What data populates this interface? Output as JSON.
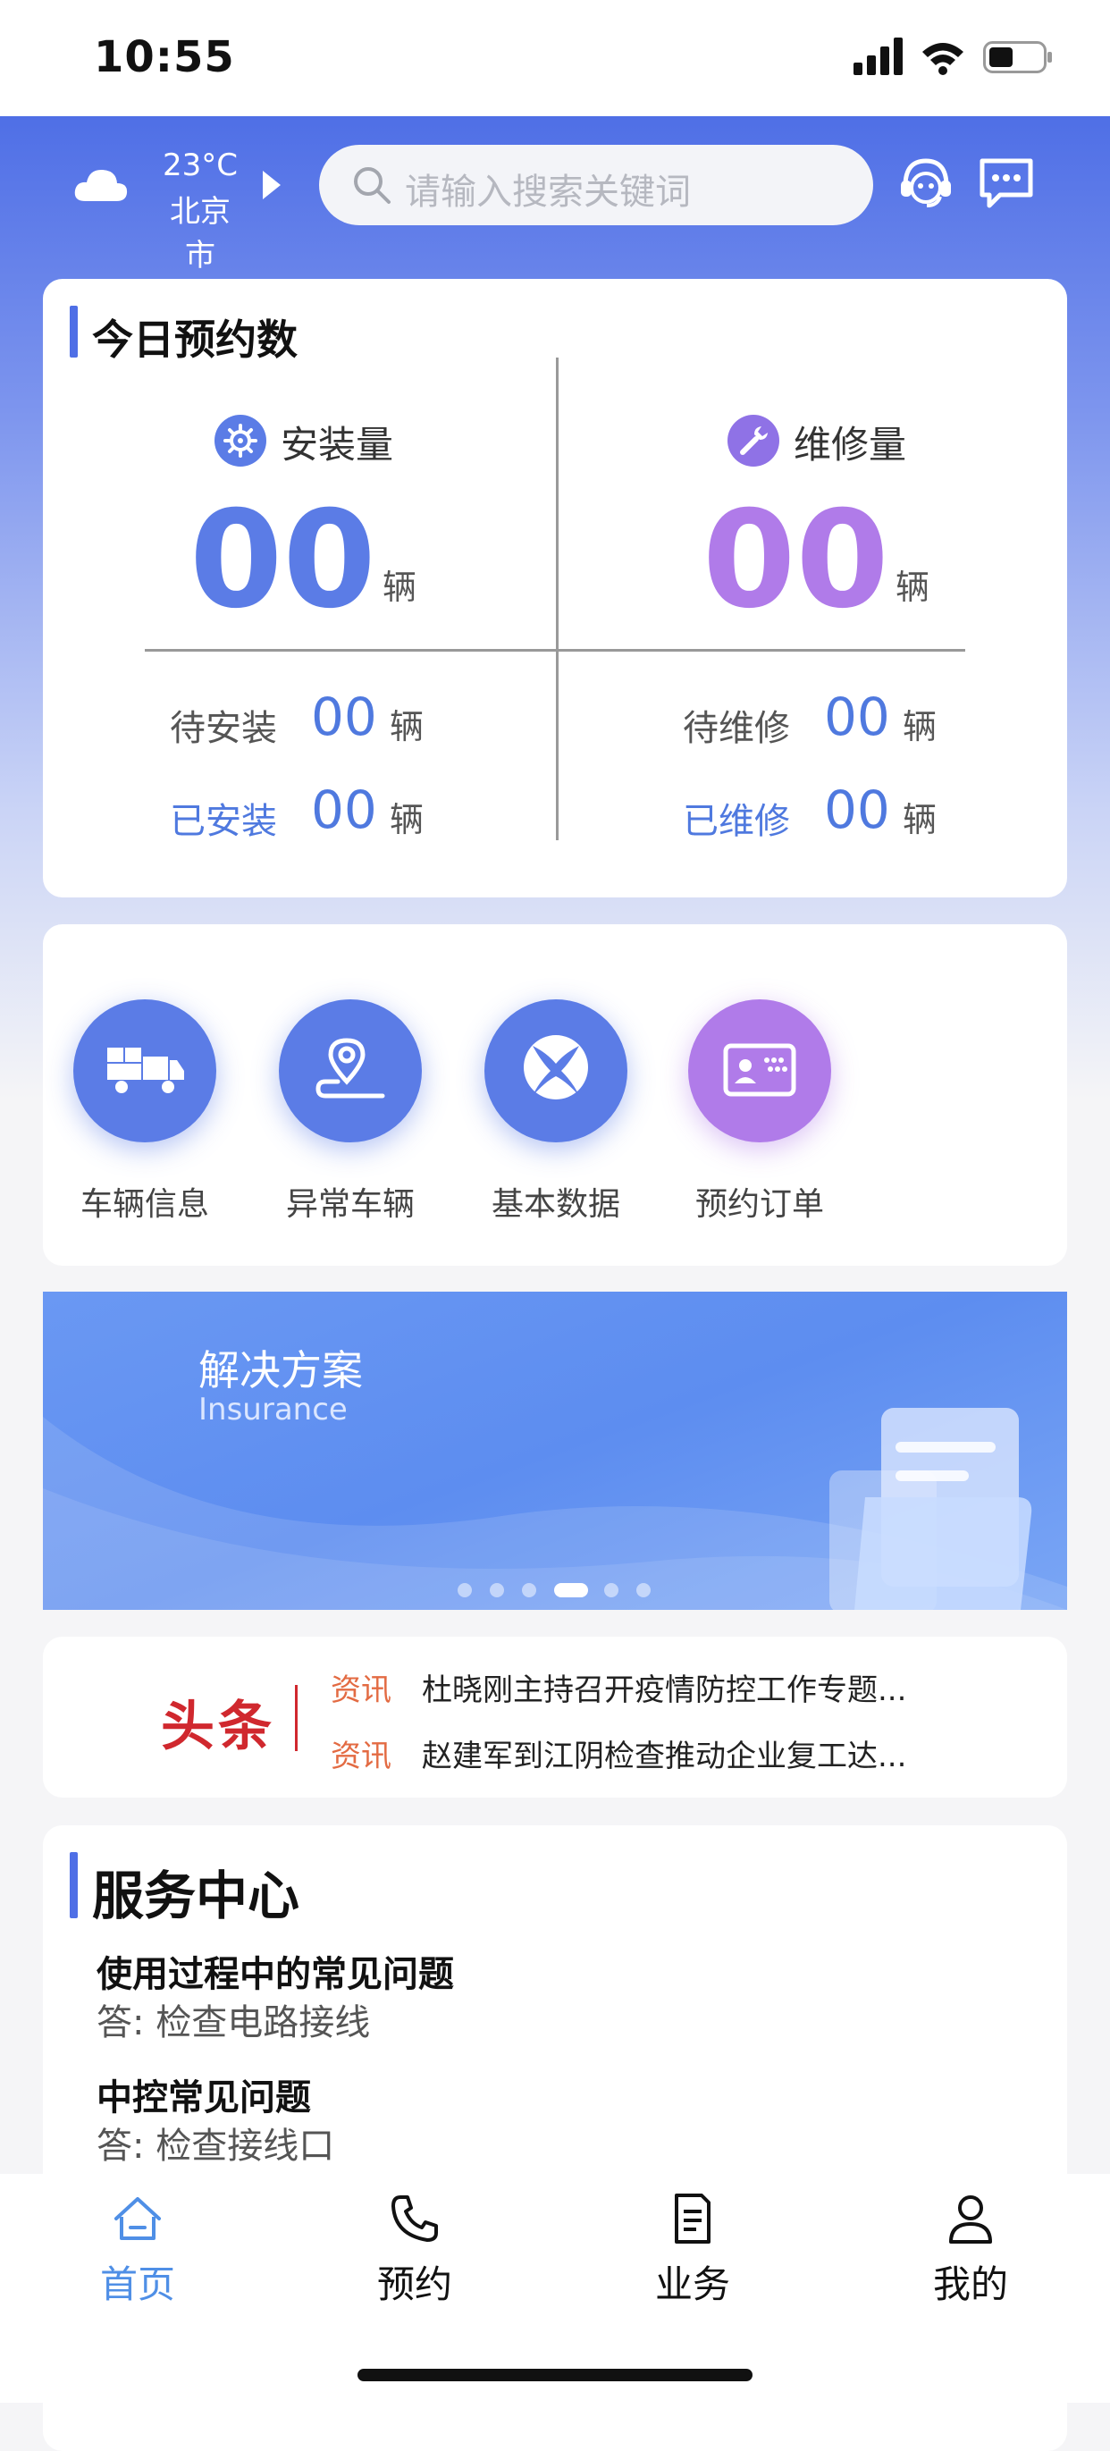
{
  "status_bar": {
    "time": "10:55"
  },
  "header": {
    "temperature": "23°C",
    "city": "北京市",
    "search_placeholder": "请输入搜索关键词"
  },
  "stats": {
    "title": "今日预约数",
    "install": {
      "label": "安装量",
      "count": "00",
      "unit": "辆",
      "pending_label": "待安装",
      "pending_count": "00",
      "pending_unit": "辆",
      "done_label": "已安装",
      "done_count": "00",
      "done_unit": "辆"
    },
    "repair": {
      "label": "维修量",
      "count": "00",
      "unit": "辆",
      "pending_label": "待维修",
      "pending_count": "00",
      "pending_unit": "辆",
      "done_label": "已维修",
      "done_count": "00",
      "done_unit": "辆"
    },
    "colors": {
      "blue": "#5b7ce6",
      "purple": "#b07be9"
    }
  },
  "menu": {
    "items": [
      {
        "label": "车辆信息",
        "icon": "truck-icon"
      },
      {
        "label": "异常车辆",
        "icon": "location-pin-icon"
      },
      {
        "label": "基本数据",
        "icon": "xbox-icon"
      },
      {
        "label": "预约订单",
        "icon": "id-card-icon"
      }
    ]
  },
  "banner": {
    "title": "解决方案",
    "subtitle": "Insurance",
    "slide_count": 6,
    "active_slide": 4
  },
  "news": {
    "headline": "头条",
    "items": [
      {
        "tag": "资讯",
        "text": "杜晓刚主持召开疫情防控工作专题..."
      },
      {
        "tag": "资讯",
        "text": "赵建军到江阴检查推动企业复工达..."
      }
    ]
  },
  "service": {
    "title": "服务中心",
    "faqs": [
      {
        "question": "使用过程中的常见问题",
        "answer": "答: 检查电路接线"
      },
      {
        "question": "中控常见问题",
        "answer": "答:  检查接线口"
      }
    ]
  },
  "tabbar": {
    "items": [
      {
        "label": "首页",
        "icon": "home-icon",
        "active": true
      },
      {
        "label": "预约",
        "icon": "phone-icon",
        "active": false
      },
      {
        "label": "业务",
        "icon": "document-icon",
        "active": false
      },
      {
        "label": "我的",
        "icon": "user-icon",
        "active": false
      }
    ]
  }
}
